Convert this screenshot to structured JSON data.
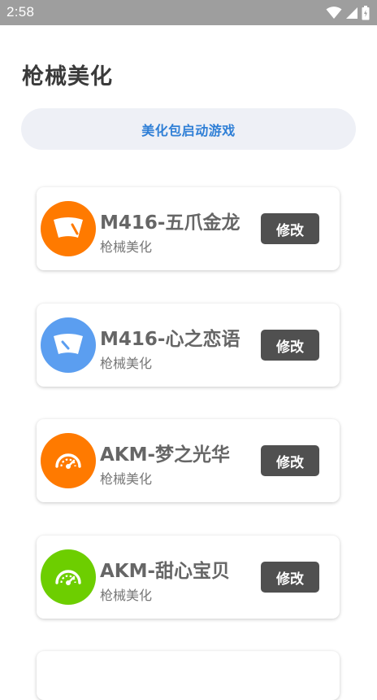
{
  "status_bar": {
    "time": "2:58",
    "icons": [
      "wifi-icon",
      "signal-icon",
      "battery-icon"
    ]
  },
  "page": {
    "title": "枪械美化"
  },
  "launch": {
    "label": "美化包启动游戏"
  },
  "items": [
    {
      "title": "M416-五爪金龙",
      "subtitle": "枪械美化",
      "button": "修改",
      "icon": "windshield-icon",
      "icon_color": "#ff7a00"
    },
    {
      "title": "M416-心之恋语",
      "subtitle": "枪械美化",
      "button": "修改",
      "icon": "windshield-icon",
      "icon_color": "#5b9ef0"
    },
    {
      "title": "AKM-梦之光华",
      "subtitle": "枪械美化",
      "button": "修改",
      "icon": "speedometer-icon",
      "icon_color": "#ff7a00"
    },
    {
      "title": "AKM-甜心宝贝",
      "subtitle": "枪械美化",
      "button": "修改",
      "icon": "speedometer-icon",
      "icon_color": "#6dce00"
    }
  ],
  "colors": {
    "status_bar": "#9e9e9e",
    "accent_text": "#2f7fd6",
    "launch_bg": "#eef0f6",
    "button_bg": "#505050"
  }
}
